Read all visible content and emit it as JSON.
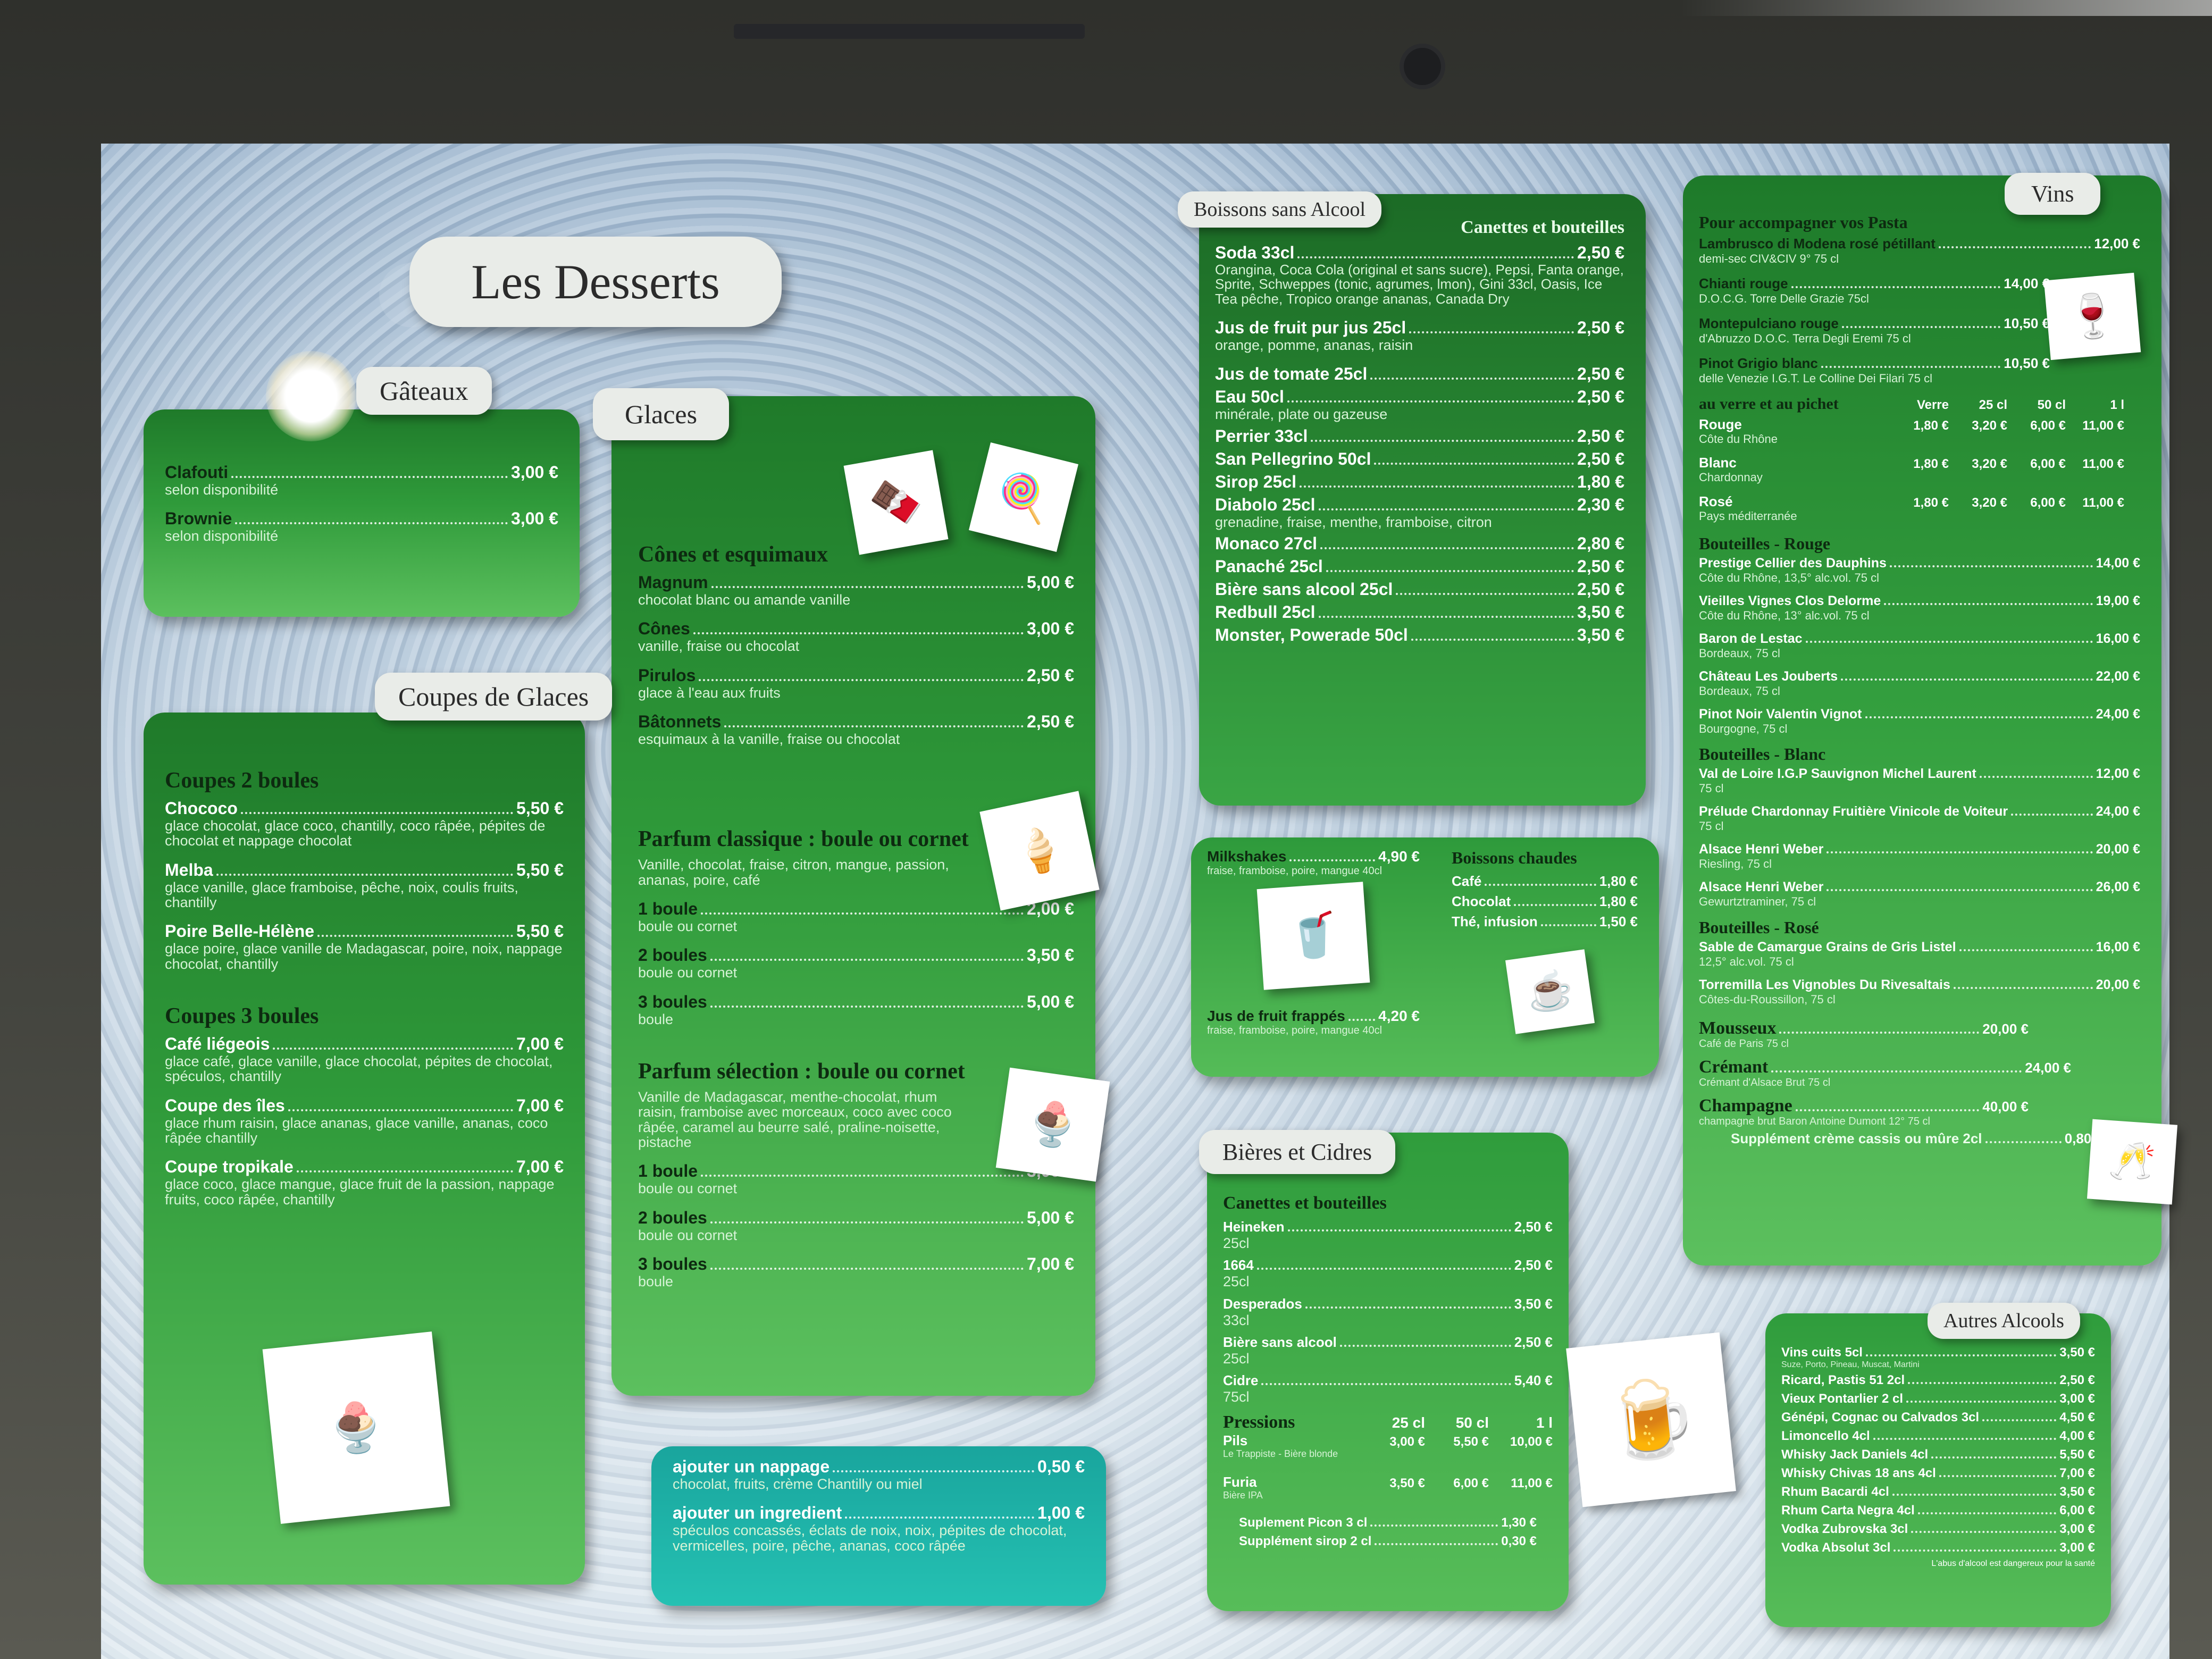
{
  "title": "Les Desserts",
  "gateaux": {
    "tab": "Gâteaux",
    "items": [
      {
        "name": "Clafouti",
        "price": "3,00 €",
        "desc": "selon disponibilité"
      },
      {
        "name": "Brownie",
        "price": "3,00 €",
        "desc": "selon disponibilité"
      }
    ]
  },
  "coupes": {
    "tab": "Coupes de Glaces",
    "sec1": "Coupes 2 boules",
    "items1": [
      {
        "name": "Chococo",
        "price": "5,50 €",
        "desc": "glace chocolat, glace coco, chantilly, coco râpée, pépites de chocolat et nappage chocolat"
      },
      {
        "name": "Melba",
        "price": "5,50 €",
        "desc": "glace vanille, glace framboise, pêche, noix, coulis fruits, chantilly"
      },
      {
        "name": "Poire Belle-Hélène",
        "price": "5,50 €",
        "desc": "glace poire, glace vanille de Madagascar, poire, noix, nappage chocolat, chantilly"
      }
    ],
    "sec2": "Coupes 3 boules",
    "items2": [
      {
        "name": "Café liégeois",
        "price": "7,00 €",
        "desc": "glace café, glace vanille, glace chocolat, pépites de chocolat, spéculos, chantilly"
      },
      {
        "name": "Coupe des îles",
        "price": "7,00 €",
        "desc": "glace rhum raisin, glace ananas, glace vanille, ananas, coco râpée chantilly"
      },
      {
        "name": "Coupe tropikale",
        "price": "7,00 €",
        "desc": "glace coco, glace mangue, glace fruit de la passion, nappage fruits, coco râpée, chantilly"
      }
    ]
  },
  "glaces": {
    "tab": "Glaces",
    "sec1": "Cônes et esquimaux",
    "items1": [
      {
        "name": "Magnum",
        "price": "5,00 €",
        "desc": "chocolat blanc ou amande vanille"
      },
      {
        "name": "Cônes",
        "price": "3,00 €",
        "desc": "vanille, fraise ou chocolat"
      },
      {
        "name": "Pirulos",
        "price": "2,50 €",
        "desc": "glace à l'eau aux fruits"
      },
      {
        "name": "Bâtonnets",
        "price": "2,50 €",
        "desc": "esquimaux à la vanille, fraise ou chocolat"
      }
    ],
    "sec2": "Parfum classique : boule ou cornet",
    "sec2_desc": "Vanille, chocolat, fraise, citron, mangue, passion, ananas, poire, café",
    "items2": [
      {
        "name": "1 boule",
        "price": "2,00 €",
        "desc": "boule ou cornet"
      },
      {
        "name": "2 boules",
        "price": "3,50 €",
        "desc": "boule ou cornet"
      },
      {
        "name": "3 boules",
        "price": "5,00 €",
        "desc": "boule"
      }
    ],
    "sec3": "Parfum sélection : boule ou cornet",
    "sec3_desc": "Vanille de Madagascar, menthe-chocolat, rhum raisin, framboise avec morceaux, coco avec coco râpée, caramel au beurre salé, praline-noisette, pistache",
    "items3": [
      {
        "name": "1 boule",
        "price": "3,00 €",
        "desc": "boule ou cornet"
      },
      {
        "name": "2 boules",
        "price": "5,00 €",
        "desc": "boule ou cornet"
      },
      {
        "name": "3 boules",
        "price": "7,00 €",
        "desc": "boule"
      }
    ]
  },
  "extras": {
    "items": [
      {
        "name": "ajouter un nappage",
        "price": "0,50 €",
        "desc": "chocolat, fruits, crème Chantilly ou miel"
      },
      {
        "name": "ajouter un ingredient",
        "price": "1,00 €",
        "desc": "spéculos concassés, éclats de noix, noix, pépites de chocolat, vermicelles, poire, pêche, ananas, coco râpée"
      }
    ]
  },
  "boissons": {
    "tab": "Boissons sans Alcool",
    "subtitle": "Canettes et bouteilles",
    "items": [
      {
        "name": "Soda 33cl",
        "price": "2,50 €",
        "desc": "Orangina, Coca Cola (original et sans sucre), Pepsi, Fanta orange, Sprite, Schweppes (tonic, agrumes, lmon), Gini 33cl, Oasis, Ice Tea pêche, Tropico orange ananas, Canada Dry"
      },
      {
        "name": "Jus de fruit pur jus 25cl",
        "price": "2,50 €",
        "desc": "orange, pomme, ananas, raisin"
      },
      {
        "name": "Jus de tomate 25cl",
        "price": "2,50 €",
        "desc": ""
      },
      {
        "name": "Eau 50cl",
        "price": "2,50 €",
        "desc": "minérale, plate ou gazeuse"
      },
      {
        "name": "Perrier 33cl",
        "price": "2,50 €",
        "desc": ""
      },
      {
        "name": "San Pellegrino 50cl",
        "price": "2,50 €",
        "desc": ""
      },
      {
        "name": "Sirop 25cl",
        "price": "1,80 €",
        "desc": ""
      },
      {
        "name": "Diabolo 25cl",
        "price": "2,30 €",
        "desc": "grenadine, fraise, menthe, framboise, citron"
      },
      {
        "name": "Monaco 27cl",
        "price": "2,80 €",
        "desc": ""
      },
      {
        "name": "Panaché 25cl",
        "price": "2,50 €",
        "desc": ""
      },
      {
        "name": "Bière sans alcool 25cl",
        "price": "2,50 €",
        "desc": ""
      },
      {
        "name": "Redbull 25cl",
        "price": "3,50 €",
        "desc": ""
      },
      {
        "name": "Monster, Powerade 50cl",
        "price": "3,50 €",
        "desc": ""
      }
    ]
  },
  "milk": {
    "milkshakes": {
      "name": "Milkshakes",
      "price": "4,90 €",
      "desc": "fraise, framboise, poire, mangue 40cl"
    },
    "jus": {
      "name": "Jus de fruit frappés",
      "price": "4,20 €",
      "desc": "fraise, framboise, poire, mangue 40cl"
    },
    "chaudes_title": "Boissons chaudes",
    "chaudes": [
      {
        "name": "Café",
        "price": "1,80 €"
      },
      {
        "name": "Chocolat",
        "price": "1,80 €"
      },
      {
        "name": "Thé, infusion",
        "price": "1,50 €"
      }
    ]
  },
  "bieres": {
    "tab": "Bières et Cidres",
    "sec1": "Canettes et bouteilles",
    "items": [
      {
        "name": "Heineken",
        "price": "2,50 €",
        "desc": "25cl"
      },
      {
        "name": "1664",
        "price": "2,50 €",
        "desc": "25cl"
      },
      {
        "name": "Desperados",
        "price": "3,50 €",
        "desc": "33cl"
      },
      {
        "name": "Bière sans alcool",
        "price": "2,50 €",
        "desc": "25cl"
      },
      {
        "name": "Cidre",
        "price": "5,40 €",
        "desc": "75cl"
      }
    ],
    "pressions": "Pressions",
    "cols": [
      "25 cl",
      "50 cl",
      "1 l"
    ],
    "p_rows": [
      {
        "name": "Pils",
        "desc": "Le Trappiste - Bière blonde",
        "p": [
          "3,00 €",
          "5,50 €",
          "10,00 €"
        ]
      },
      {
        "name": "Furia",
        "desc": "Bière IPA",
        "p": [
          "3,50 €",
          "6,00 €",
          "11,00 €"
        ]
      }
    ],
    "supps": [
      {
        "name": "Suplement Picon 3 cl",
        "price": "1,30 €"
      },
      {
        "name": "Supplément sirop 2 cl",
        "price": "0,30 €"
      }
    ]
  },
  "vins": {
    "tab": "Vins",
    "intro": "Pour accompagner vos Pasta",
    "top": [
      {
        "name": "Lambrusco di Modena rosé pétillant",
        "price": "12,00 €",
        "desc": "demi-sec CIV&CIV 9° 75 cl"
      },
      {
        "name": "Chianti rouge",
        "price": "14,00 €",
        "desc": "D.O.C.G. Torre Delle Grazie 75cl"
      },
      {
        "name": "Montepulciano rouge",
        "price": "10,50 €",
        "desc": "d'Abruzzo D.O.C. Terra Degli Eremi 75 cl"
      },
      {
        "name": "Pinot Grigio blanc",
        "price": "10,50 €",
        "desc": "delle Venezie I.G.T. Le Colline Dei Filari 75 cl"
      }
    ],
    "verre_title": "au verre et au pichet",
    "verre_cols": [
      "Verre",
      "25 cl",
      "50 cl",
      "1 l"
    ],
    "verre": [
      {
        "name": "Rouge",
        "desc": "Côte du Rhône",
        "p": [
          "1,80 €",
          "3,20 €",
          "6,00 €",
          "11,00 €"
        ]
      },
      {
        "name": "Blanc",
        "desc": "Chardonnay",
        "p": [
          "1,80 €",
          "3,20 €",
          "6,00 €",
          "11,00 €"
        ]
      },
      {
        "name": "Rosé",
        "desc": "Pays méditerranée",
        "p": [
          "1,80 €",
          "3,20 €",
          "6,00 €",
          "11,00 €"
        ]
      }
    ],
    "rouge_title": "Bouteilles - Rouge",
    "rouge": [
      {
        "name": "Prestige Cellier des Dauphins",
        "price": "14,00 €",
        "desc": "Côte du Rhône, 13,5° alc.vol. 75 cl"
      },
      {
        "name": "Vieilles Vignes Clos Delorme",
        "price": "19,00 €",
        "desc": "Côte du Rhône, 13° alc.vol. 75 cl"
      },
      {
        "name": "Baron de Lestac",
        "price": "16,00 €",
        "desc": "Bordeaux, 75 cl"
      },
      {
        "name": "Château Les Jouberts",
        "price": "22,00 €",
        "desc": "Bordeaux, 75 cl"
      },
      {
        "name": "Pinot Noir Valentin Vignot",
        "price": "24,00 €",
        "desc": "Bourgogne, 75 cl"
      }
    ],
    "blanc_title": "Bouteilles - Blanc",
    "blanc": [
      {
        "name": "Val de Loire I.G.P Sauvignon Michel Laurent",
        "price": "12,00 €",
        "desc": "75 cl"
      },
      {
        "name": "Prélude Chardonnay Fruitière Vinicole de Voiteur",
        "price": "24,00 €",
        "desc": "75 cl"
      },
      {
        "name": "Alsace Henri Weber",
        "price": "20,00 €",
        "desc": "Riesling, 75 cl"
      },
      {
        "name": "Alsace Henri Weber",
        "price": "26,00 €",
        "desc": "Gewurtztraminer, 75 cl"
      }
    ],
    "rose_title": "Bouteilles - Rosé",
    "rose": [
      {
        "name": "Sable de Camargue Grains de Gris Listel",
        "price": "16,00 €",
        "desc": "12,5° alc.vol. 75 cl"
      },
      {
        "name": "Torremilla Les Vignobles Du Rivesaltais",
        "price": "20,00 €",
        "desc": "Côtes-du-Roussillon, 75 cl"
      }
    ],
    "bulles": [
      {
        "name": "Mousseux",
        "price": "20,00 €",
        "desc": "Café de Paris 75 cl"
      },
      {
        "name": "Crémant",
        "price": "24,00 €",
        "desc": "Crémant d'Alsace Brut 75 cl"
      },
      {
        "name": "Champagne",
        "price": "40,00 €",
        "desc": "champagne brut Baron Antoine Dumont 12° 75 cl"
      }
    ],
    "supp": "Supplément crème cassis ou mûre 2cl",
    "supp_price": "0,80 €"
  },
  "autres": {
    "tab": "Autres Alcools",
    "items": [
      {
        "name": "Vins cuits 5cl",
        "price": "3,50 €",
        "desc": "Suze, Porto, Pineau, Muscat, Martini"
      },
      {
        "name": "Ricard, Pastis 51 2cl",
        "price": "2,50 €",
        "desc": ""
      },
      {
        "name": "Vieux Pontarlier 2 cl",
        "price": "3,00 €",
        "desc": ""
      },
      {
        "name": "Génépi, Cognac ou Calvados 3cl",
        "price": "4,50 €",
        "desc": ""
      },
      {
        "name": "Limoncello 4cl",
        "price": "4,00 €",
        "desc": ""
      },
      {
        "name": "Whisky Jack Daniels 4cl",
        "price": "5,50 €",
        "desc": ""
      },
      {
        "name": "Whisky Chivas 18 ans 4cl",
        "price": "7,00 €",
        "desc": ""
      },
      {
        "name": "Rhum Bacardi 4cl",
        "price": "3,50 €",
        "desc": ""
      },
      {
        "name": "Rhum Carta Negra 4cl",
        "price": "6,00 €",
        "desc": ""
      },
      {
        "name": "Vodka Zubrovska 3cl",
        "price": "3,00 €",
        "desc": ""
      },
      {
        "name": "Vodka Absolut 3cl",
        "price": "3,00 €",
        "desc": ""
      }
    ],
    "footer": "L'abus d'alcool est dangereux pour la santé"
  }
}
